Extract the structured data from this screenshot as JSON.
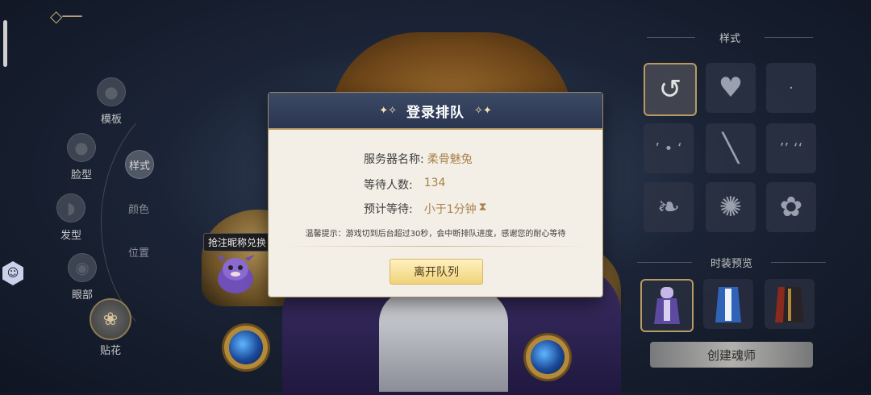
{
  "left_menu": {
    "items": [
      {
        "label": "模板",
        "icon": "template-head-icon"
      },
      {
        "label": "脸型",
        "icon": "face-shape-icon"
      },
      {
        "label": "发型",
        "icon": "hairstyle-icon"
      },
      {
        "label": "眼部",
        "icon": "eye-icon"
      },
      {
        "label": "贴花",
        "icon": "decal-emblem-icon"
      }
    ],
    "sub_items": [
      "样式",
      "颜色",
      "位置"
    ]
  },
  "nickname_tag": "抢注昵称兑换",
  "right_panel": {
    "style_title": "样式",
    "style_icons": [
      "reset-circle-icon",
      "heart-icon",
      "dot-icon",
      "dash-marks-icon",
      "slash-icon",
      "lash-marks-icon",
      "flame-icon",
      "spiral-icon",
      "pinwheel-icon"
    ],
    "preview_title": "时装预览",
    "preview_items": [
      "costume-purple-icon",
      "costume-blue-icon",
      "costume-dark-icon"
    ],
    "create_button": "创建魂师"
  },
  "dialog": {
    "title": "登录排队",
    "server_label": "服务器名称:",
    "server_value": "柔骨魅兔",
    "waiting_label": "等待人数:",
    "waiting_value": "134",
    "eta_label": "预计等待:",
    "eta_value": "小于1分钟",
    "hint": "温馨提示：游戏切到后台超过30秒，会中断排队进度，感谢您的耐心等待",
    "leave_button": "离开队列"
  },
  "colors": {
    "accent_gold": "#b89a62",
    "dialog_header": "#2a3550",
    "value_text": "#a8824a"
  }
}
